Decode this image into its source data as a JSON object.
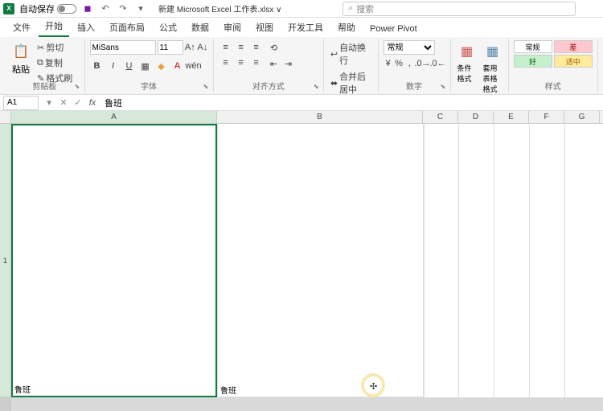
{
  "titlebar": {
    "autosave_label": "自动保存",
    "doc_title": "新建 Microsoft Excel 工作表.xlsx ∨",
    "search_placeholder": "搜索"
  },
  "tabs": {
    "file": "文件",
    "home": "开始",
    "insert": "插入",
    "layout": "页面布局",
    "formulas": "公式",
    "data": "数据",
    "review": "审阅",
    "view": "视图",
    "dev": "开发工具",
    "help": "帮助",
    "powerpivot": "Power Pivot"
  },
  "ribbon": {
    "paste": "粘贴",
    "cut": "剪切",
    "copy": "复制",
    "format_painter": "格式刷",
    "clipboard_group": "剪贴板",
    "font_name": "MiSans",
    "font_size": "11",
    "font_group": "字体",
    "align_group": "对齐方式",
    "wrap_text": "自动换行",
    "merge_center": "合并后居中",
    "number_format": "常规",
    "number_group": "数字",
    "cond_format": "条件格式",
    "table_format": "套用表格格式",
    "style_normal": "常规",
    "style_bad": "差",
    "style_good": "好",
    "style_neutral": "适中",
    "styles_group": "样式"
  },
  "formula_bar": {
    "cell_ref": "A1",
    "formula": "鲁班"
  },
  "columns": {
    "a": "A",
    "b": "B",
    "c": "C",
    "d": "D",
    "e": "E",
    "f": "F",
    "g": "G"
  },
  "rows": {
    "r1": "1"
  },
  "cells": {
    "a1": "鲁班",
    "b1": "鲁班"
  }
}
